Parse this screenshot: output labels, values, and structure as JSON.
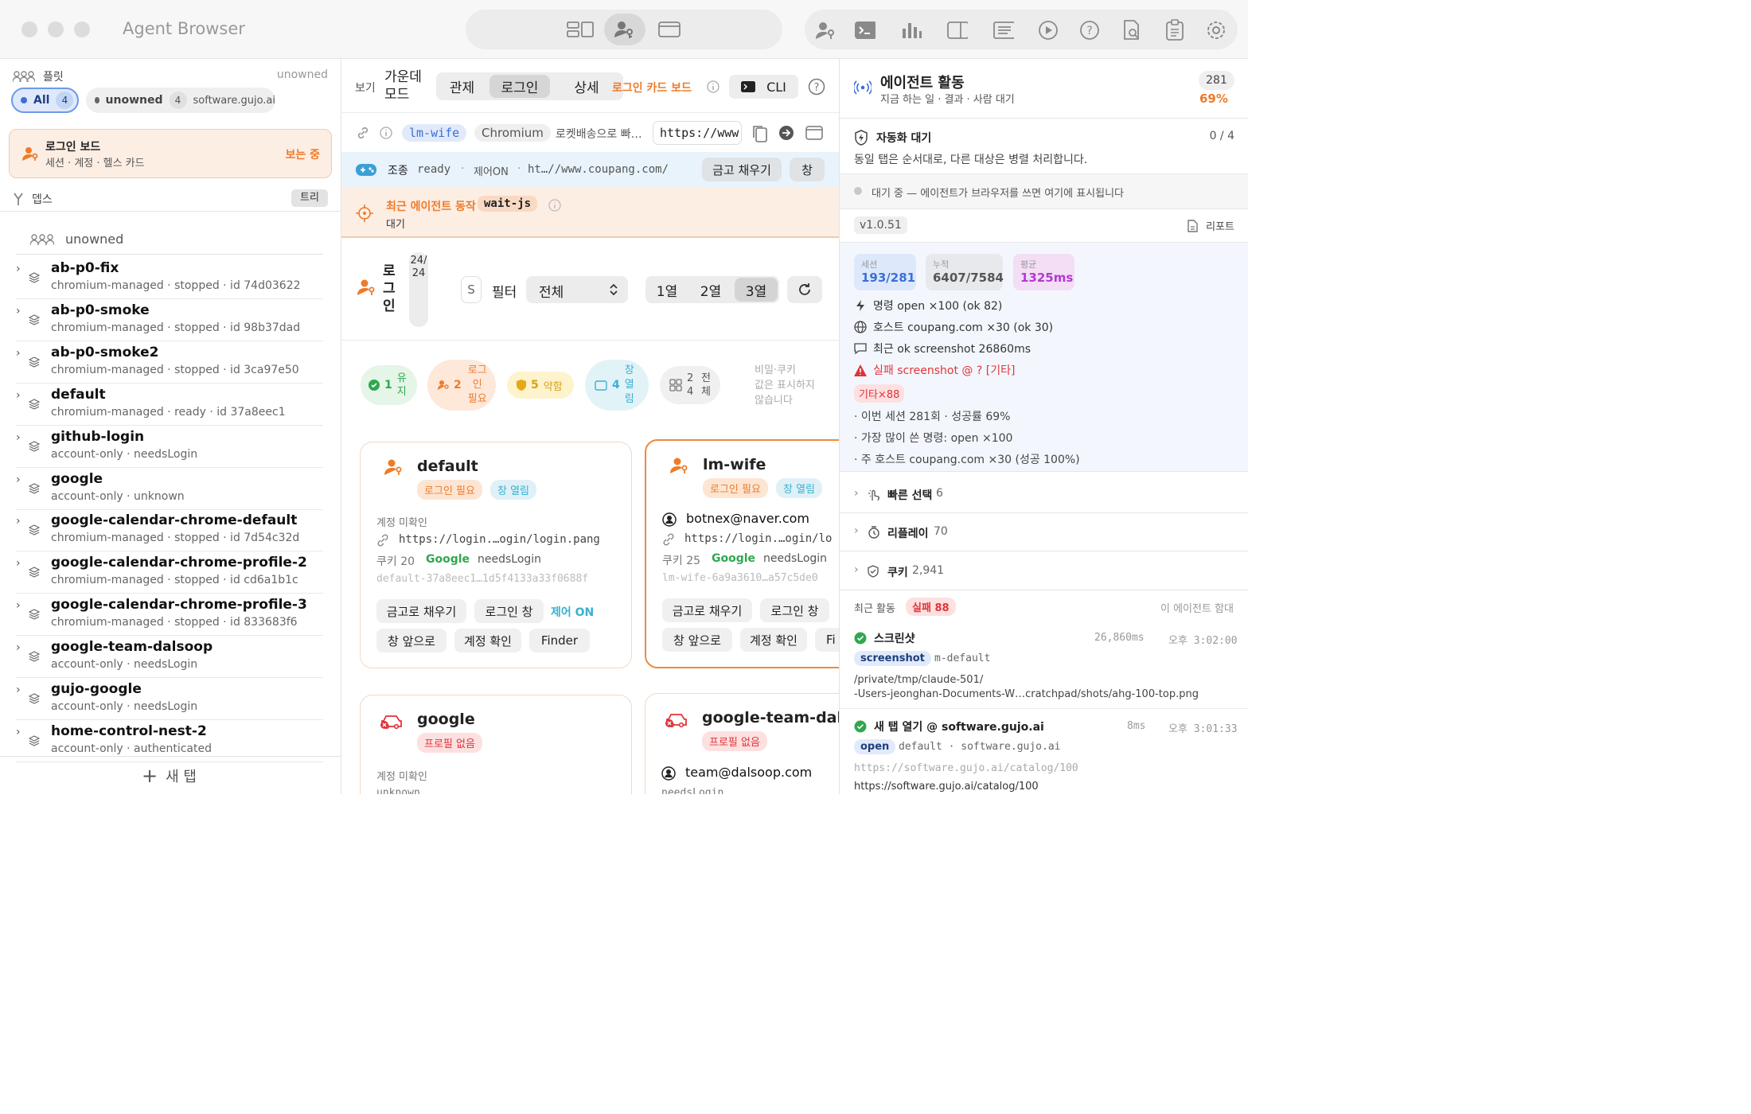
{
  "window": {
    "title": "Agent Browser"
  },
  "left": {
    "fleet_label": "플릿",
    "fleet_owner": "unowned",
    "chips": [
      {
        "label": "All",
        "count": "4"
      },
      {
        "label": "unowned",
        "count": "4",
        "host": "software.gujo.ai"
      }
    ],
    "login_board": {
      "title": "로그인 보드",
      "subtitle": "세션 · 계정 · 헬스 카드",
      "status": "보는 중"
    },
    "depth_label": "뎁스",
    "tree_button": "트리",
    "group_label": "unowned",
    "profiles": [
      {
        "name": "ab-p0-fix",
        "sub": "chromium-managed · stopped · id 74d03622"
      },
      {
        "name": "ab-p0-smoke",
        "sub": "chromium-managed · stopped · id 98b37dad"
      },
      {
        "name": "ab-p0-smoke2",
        "sub": "chromium-managed · stopped · id 3ca97e50"
      },
      {
        "name": "default",
        "sub": "chromium-managed · ready · id 37a8eec1"
      },
      {
        "name": "github-login",
        "sub": "account-only · needsLogin"
      },
      {
        "name": "google",
        "sub": "account-only · unknown"
      },
      {
        "name": "google-calendar-chrome-default",
        "sub": "chromium-managed · stopped · id 7d54c32d"
      },
      {
        "name": "google-calendar-chrome-profile-2",
        "sub": "chromium-managed · stopped · id cd6a1b1c"
      },
      {
        "name": "google-calendar-chrome-profile-3",
        "sub": "chromium-managed · stopped · id 833683f6"
      },
      {
        "name": "google-team-dalsoop",
        "sub": "account-only · needsLogin"
      },
      {
        "name": "gujo-google",
        "sub": "account-only · needsLogin"
      },
      {
        "name": "home-control-nest-2",
        "sub": "account-only · authenticated"
      }
    ],
    "new_tab": "새 탭"
  },
  "middle": {
    "view_label": "보기",
    "mode_label": "가운데\n모드",
    "modes": [
      "관제",
      "로그인",
      "상세"
    ],
    "board_link": "로그인 카드 보드",
    "cli": "CLI",
    "tab_chip": "lm-wife",
    "browser_chip": "Chromium",
    "tab_title": "로켓배송으로 빠…",
    "url": "https://www",
    "control": {
      "label": "조종",
      "state": "ready",
      "ctrl": "제어ON",
      "url": "ht…//www.coupang.com/",
      "fill_btn": "금고 채우기",
      "win_btn": "창"
    },
    "recent": {
      "label": "최근 에이전트 동작",
      "action": "wait-js",
      "status": "대기"
    },
    "login_section": {
      "title": "로그인",
      "count": "24/24",
      "s_btn": "S",
      "filter_label": "필터",
      "filter_value": "전체",
      "cols": [
        "1열",
        "2열",
        "3열"
      ]
    },
    "stats": [
      {
        "n": "1",
        "label": "유지"
      },
      {
        "n": "2",
        "label": "로그인 필요"
      },
      {
        "n": "5",
        "label": "약함"
      },
      {
        "n": "4",
        "label": "창 열림"
      },
      {
        "n": "24",
        "label": "전체"
      }
    ],
    "secret_note": "비밀·쿠키\n값은 표시하지\n않습니다",
    "cards": [
      {
        "name": "default",
        "tag1": "로그인 필요",
        "tag2": "창 열림",
        "account": "계정 미확인",
        "login_url": "https://login.…ogin/login.pang",
        "cookies": "쿠키 20",
        "provider": "Google",
        "state": "needsLogin",
        "id": "default-37a8eec1…1d5f4133a33f0688f",
        "btn_fill": "금고로 채우기",
        "btn_login": "로그인 창",
        "ctrl": "제어 ON",
        "btn_front": "창 앞으로",
        "btn_acct": "계정 확인",
        "btn_finder": "Finder"
      },
      {
        "name": "lm-wife",
        "tag1": "로그인 필요",
        "tag2": "창 열림",
        "account": "botnex@naver.com",
        "login_url": "https://login.…ogin/lo",
        "cookies": "쿠키 25",
        "provider": "Google",
        "state": "needsLogin",
        "id": "lm-wife-6a9a3610…a57c5de0",
        "btn_fill": "금고로 채우기",
        "btn_login": "로그인 창",
        "btn_front": "창 앞으로",
        "btn_acct": "계정 확인",
        "btn_finder": "Fi"
      },
      {
        "name": "google",
        "tag1": "프로필 없음",
        "account": "계정 미확인",
        "state": "unknown"
      },
      {
        "name": "google-team-dalsoop",
        "tag1": "프로필 없음",
        "account": "team@dalsoop.com",
        "state": "needsLogin"
      }
    ]
  },
  "right": {
    "title": "에이전트 활동",
    "subtitle": "지금 하는 일 · 결과 · 사람 대기",
    "count": "281",
    "rate": "69%",
    "auto": {
      "title": "자동화 대기",
      "count": "0 / 4",
      "desc": "동일 탭은 순서대로, 다른 대상은 병렬 처리합니다."
    },
    "waiting": "대기 중 — 에이전트가 브라우저를 쓰면 여기에 표시됩니다",
    "version": "v1.0.51",
    "report": "리포트",
    "stats": [
      {
        "label": "세션",
        "value": "193/281"
      },
      {
        "label": "누적",
        "value": "6407/7584"
      },
      {
        "label": "평균",
        "value": "1325ms"
      }
    ],
    "metrics": [
      "명령 open ×100 (ok 82)",
      "호스트 coupang.com ×30 (ok 30)",
      "최근 ok screenshot 26860ms",
      "실패 screenshot @ ? [기타]"
    ],
    "fail_tag": "기타×88",
    "notes": [
      "· 이번 세션 281회 · 성공률 69%",
      "· 가장 많이 쓴 명령: open ×100",
      "· 주 호스트 coupang.com ×30 (성공 100%)"
    ],
    "collapsibles": [
      {
        "label": "빠른 선택",
        "count": "6"
      },
      {
        "label": "리플레이",
        "count": "70"
      },
      {
        "label": "쿠키",
        "count": "2,941"
      }
    ],
    "recent_label": "최근 활동",
    "fail_badge": "실패 88",
    "with_agent": "이 에이전트 함대",
    "activities": [
      {
        "title": "스크린샷",
        "ms": "26,860ms",
        "time": "오후 3:02:00",
        "cmd": "screenshot",
        "target": "m-default",
        "path": "/private/tmp/claude-501/\n-Users-jeonghan-Documents-W…cratchpad/shots/ahg-100-top.png"
      },
      {
        "title": "새 탭 열기 @ software.gujo.ai",
        "ms": "8ms",
        "time": "오후 3:01:33",
        "cmd": "open",
        "target": "default · software.gujo.ai",
        "url1": "https://software.gujo.ai/catalog/100",
        "url2": "https://software.gujo.ai/catalog/100"
      }
    ]
  },
  "colors": {
    "orange": "#ee7b2a",
    "blue": "#3a6fd8",
    "green": "#2fa84f",
    "red": "#e0343a",
    "purple": "#b33ad0"
  }
}
